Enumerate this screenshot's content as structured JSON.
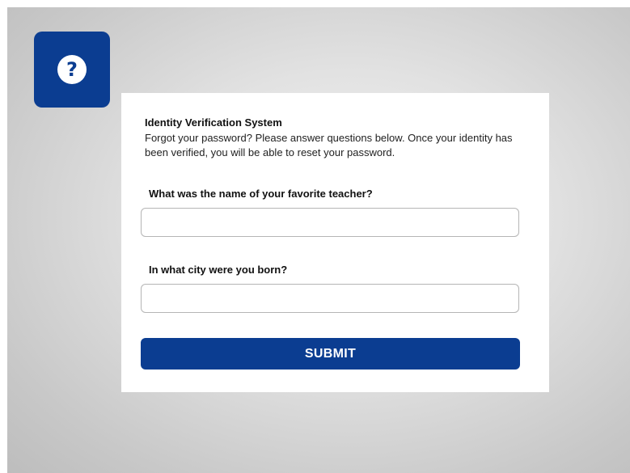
{
  "help_icon": {
    "icon": "question-mark-icon",
    "glyph": "?",
    "color": "#0b3d91"
  },
  "form": {
    "heading": "Identity Verification System",
    "intro": "Forgot your password? Please answer questions below. Once your identity has been verified, you will be able to reset your password.",
    "questions": [
      {
        "label": "What was the name of your favorite teacher?",
        "value": "",
        "placeholder": ""
      },
      {
        "label": "In what city were you born?",
        "value": "",
        "placeholder": ""
      }
    ],
    "submit_label": "SUBMIT"
  },
  "colors": {
    "accent": "#0b3d91",
    "card_background": "#ffffff",
    "stage_background": "#d9d9d9"
  }
}
